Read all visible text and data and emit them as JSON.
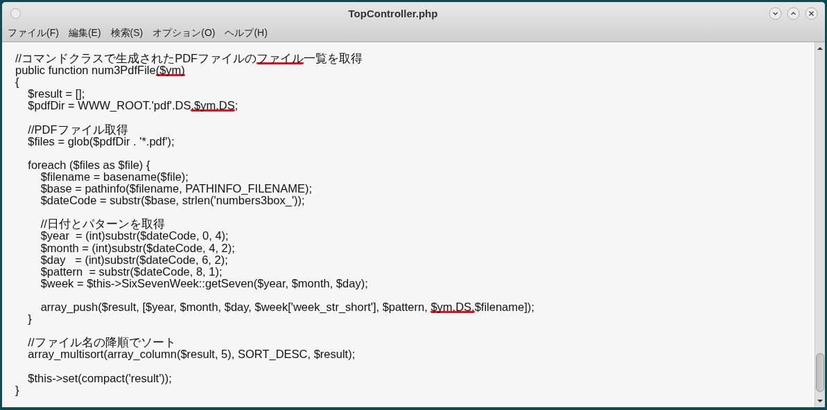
{
  "window": {
    "title": "TopController.php"
  },
  "menu": [
    "ファイル(F)",
    "編集(E)",
    "検索(S)",
    "オプション(O)",
    "ヘルプ(H)"
  ],
  "editor": {
    "lines": [
      {
        "kind": "code",
        "segments": [
          {
            "text": "//コマンドクラスで生成されたPDFファイルの",
            "marked": false
          },
          {
            "text": "ファイル",
            "marked": true
          },
          {
            "text": "一覧を取得",
            "marked": false
          }
        ]
      },
      {
        "kind": "code",
        "segments": [
          {
            "text": "public function num3PdfFile",
            "marked": false
          },
          {
            "text": "($ym)",
            "marked": true
          }
        ]
      },
      {
        "kind": "code",
        "segments": [
          {
            "text": "{",
            "marked": false
          }
        ]
      },
      {
        "kind": "code",
        "segments": [
          {
            "text": "    $result = [];",
            "marked": false
          }
        ]
      },
      {
        "kind": "code",
        "segments": [
          {
            "text": "    $pdfDir = WWW_ROOT.'pdf'.DS",
            "marked": false
          },
          {
            "text": ".$ym.DS",
            "marked": true
          },
          {
            "text": ";",
            "marked": false
          }
        ]
      },
      {
        "kind": "blank"
      },
      {
        "kind": "code",
        "segments": [
          {
            "text": "    //PDFファイル取得",
            "marked": false
          }
        ]
      },
      {
        "kind": "code",
        "segments": [
          {
            "text": "    $files = glob($pdfDir . '*.pdf');",
            "marked": false
          }
        ]
      },
      {
        "kind": "blank"
      },
      {
        "kind": "code",
        "segments": [
          {
            "text": "    foreach ($files as $file) {",
            "marked": false
          }
        ]
      },
      {
        "kind": "code",
        "segments": [
          {
            "text": "        $filename = basename($file);",
            "marked": false
          }
        ]
      },
      {
        "kind": "code",
        "segments": [
          {
            "text": "        $base = pathinfo($filename, PATHINFO_FILENAME);",
            "marked": false
          }
        ]
      },
      {
        "kind": "code",
        "segments": [
          {
            "text": "        $dateCode = substr($base, strlen('numbers3box_'));",
            "marked": false
          }
        ]
      },
      {
        "kind": "blank"
      },
      {
        "kind": "code",
        "segments": [
          {
            "text": "        //日付とパターンを取得",
            "marked": false
          }
        ]
      },
      {
        "kind": "code",
        "segments": [
          {
            "text": "        $year  = (int)substr($dateCode, 0, 4);",
            "marked": false
          }
        ]
      },
      {
        "kind": "code",
        "segments": [
          {
            "text": "        $month = (int)substr($dateCode, 4, 2);",
            "marked": false
          }
        ]
      },
      {
        "kind": "code",
        "segments": [
          {
            "text": "        $day   = (int)substr($dateCode, 6, 2);",
            "marked": false
          }
        ]
      },
      {
        "kind": "code",
        "segments": [
          {
            "text": "        $pattern  = substr($dateCode, 8, 1);",
            "marked": false
          }
        ]
      },
      {
        "kind": "code",
        "segments": [
          {
            "text": "        $week = $this->SixSevenWeek::getSeven($year, $month, $day);",
            "marked": false
          }
        ]
      },
      {
        "kind": "blank"
      },
      {
        "kind": "code",
        "segments": [
          {
            "text": "        array_push($result, [$year, $month, $day, $week['week_str_short'], $pattern, ",
            "marked": false
          },
          {
            "text": "$ym.DS.",
            "marked": true
          },
          {
            "text": "$filename]);",
            "marked": false
          }
        ]
      },
      {
        "kind": "code",
        "segments": [
          {
            "text": "    }",
            "marked": false
          }
        ]
      },
      {
        "kind": "blank"
      },
      {
        "kind": "code",
        "segments": [
          {
            "text": "    //ファイル名の降順でソート",
            "marked": false
          }
        ]
      },
      {
        "kind": "code",
        "segments": [
          {
            "text": "    array_multisort(array_column($result, 5), SORT_DESC, $result);",
            "marked": false
          }
        ]
      },
      {
        "kind": "blank"
      },
      {
        "kind": "code",
        "segments": [
          {
            "text": "    $this->set(compact('result'));",
            "marked": false
          }
        ]
      },
      {
        "kind": "code",
        "segments": [
          {
            "text": "}",
            "marked": false
          }
        ]
      }
    ]
  }
}
